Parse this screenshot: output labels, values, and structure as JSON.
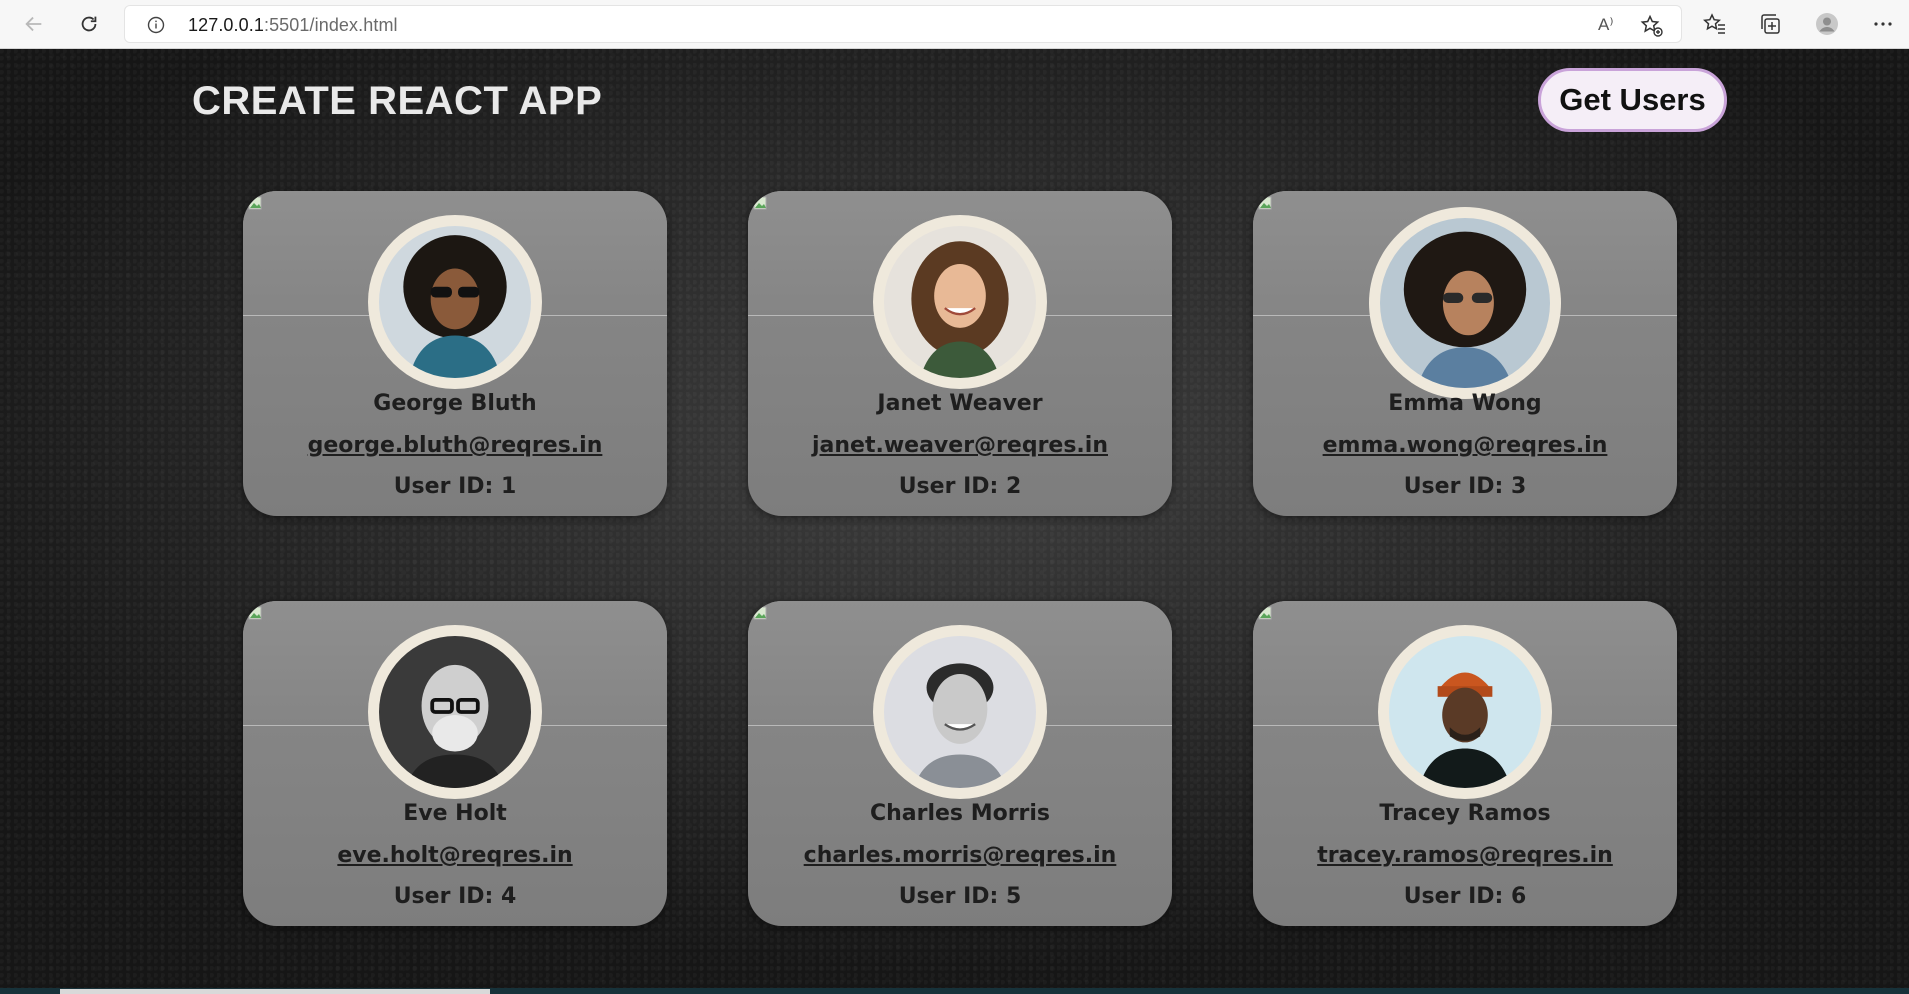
{
  "browser": {
    "url_host": "127.0.0.1",
    "url_rest": ":5501/index.html",
    "read_aloud_label": "A⁾"
  },
  "header": {
    "title": "CREATE REACT APP",
    "button_label": "Get Users"
  },
  "users": [
    {
      "name": "George Bluth",
      "email": "george.bluth@reqres.in",
      "id_label": "User ID: 1"
    },
    {
      "name": "Janet Weaver",
      "email": "janet.weaver@reqres.in",
      "id_label": "User ID: 2"
    },
    {
      "name": "Emma Wong",
      "email": "emma.wong@reqres.in",
      "id_label": "User ID: 3"
    },
    {
      "name": "Eve Holt",
      "email": "eve.holt@reqres.in",
      "id_label": "User ID: 4"
    },
    {
      "name": "Charles Morris",
      "email": "charles.morris@reqres.in",
      "id_label": "User ID: 5"
    },
    {
      "name": "Tracey Ramos",
      "email": "tracey.ramos@reqres.in",
      "id_label": "User ID: 6"
    }
  ],
  "colors": {
    "button_bg": "#f5eef7",
    "button_border": "#c9a3d9",
    "card_bg": "#858585",
    "avatar_ring": "#efe9dc",
    "title": "#e9e9e9"
  }
}
